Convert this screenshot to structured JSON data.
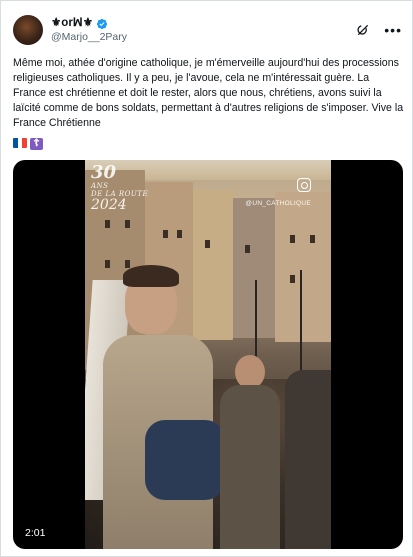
{
  "post": {
    "display_name": "⚜orꟽ⚜",
    "handle": "@Marjo__2Pary",
    "text": "Même moi, athée d'origine catholique, je m'émerveille aujourd'hui des processions religieuses catholiques. Il y a peu, je l'avoue, cela ne m'intéressait guère. La France est chrétienne et doit le rester, alors que nous, chrétiens, avons suivi la laïcité comme de bons soldats, permettant à d'autres religions de s'imposer. Vive la France Chrétienne",
    "emoji": [
      "flag-france",
      "orthodox-cross"
    ]
  },
  "video": {
    "overlay_logo_number": "30",
    "overlay_logo_ans": "ANS",
    "overlay_logo_route": "DE LA ROUTE",
    "overlay_logo_year": "2024",
    "overlay_handle": "@UN_CATHOLIQUE",
    "duration": "2:01"
  },
  "icons": {
    "verified": "verified-badge-icon",
    "grok": "grok-icon",
    "more": "more-options-icon",
    "instagram": "instagram-icon"
  },
  "colors": {
    "verified_blue": "#1d9bf0",
    "text": "#0f1419",
    "secondary_text": "#536471",
    "fleur_purple": "#6e4bb5"
  }
}
